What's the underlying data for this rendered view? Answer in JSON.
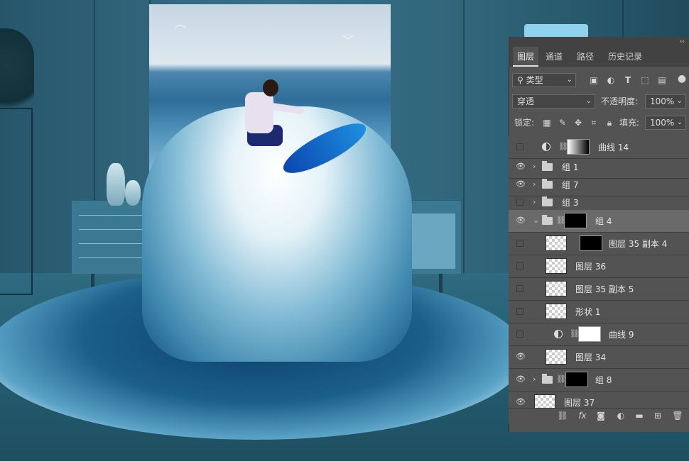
{
  "panel": {
    "collapse_glyph": "‹‹",
    "tabs": [
      {
        "label": "图层",
        "active": true
      },
      {
        "label": "通道",
        "active": false
      },
      {
        "label": "路径",
        "active": false
      },
      {
        "label": "历史记录",
        "active": false
      }
    ],
    "filter": {
      "label": "类型",
      "icons": [
        "image-filter-icon",
        "adjustment-filter-icon",
        "type-filter-icon",
        "shape-filter-icon",
        "smart-object-filter-icon"
      ]
    },
    "blend_mode": "穿透",
    "opacity_label": "不透明度:",
    "opacity_value": "100%",
    "lock_label": "锁定:",
    "fill_label": "填充:",
    "fill_value": "100%",
    "layers": [
      {
        "name": "曲线 14",
        "visible": false,
        "kind": "adjustment"
      },
      {
        "name": "组 1",
        "visible": true,
        "kind": "group"
      },
      {
        "name": "组 7",
        "visible": true,
        "kind": "group"
      },
      {
        "name": "组 3",
        "visible": false,
        "kind": "group"
      },
      {
        "name": "组 4",
        "visible": true,
        "kind": "group-open",
        "selected": true
      },
      {
        "name": "图层 35 副本 4",
        "visible": false,
        "kind": "pixel-mask"
      },
      {
        "name": "图层 36",
        "visible": false,
        "kind": "pixel"
      },
      {
        "name": "图层 35 副本 5",
        "visible": false,
        "kind": "pixel"
      },
      {
        "name": "形状 1",
        "visible": false,
        "kind": "shape"
      },
      {
        "name": "曲线 9",
        "visible": false,
        "kind": "adjustment"
      },
      {
        "name": "图层 34",
        "visible": true,
        "kind": "smart"
      },
      {
        "name": "组 8",
        "visible": true,
        "kind": "group"
      },
      {
        "name": "图层 37",
        "visible": true,
        "kind": "pixel"
      }
    ],
    "bottom_icons": [
      "link-layers-icon",
      "fx-icon",
      "add-mask-icon",
      "new-adjustment-icon",
      "new-group-icon",
      "new-layer-icon",
      "delete-layer-icon"
    ],
    "fx_glyph": "fx"
  },
  "colors": {
    "panel_bg": "#535353",
    "panel_dark": "#424242",
    "selected_row": "#6a6a6a"
  }
}
